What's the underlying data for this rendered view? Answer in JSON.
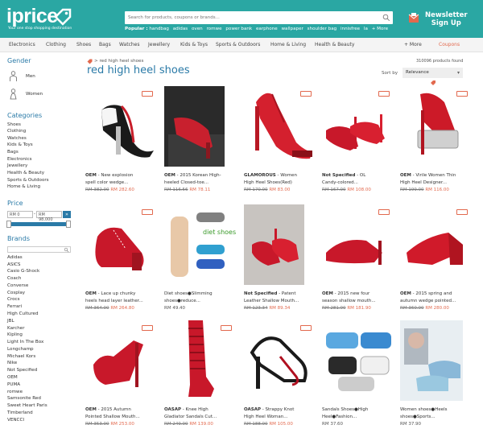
{
  "header": {
    "logo": "iprice",
    "tagline": "Your one stop shopping destination",
    "search_placeholder": "Search for products, coupons or brands...",
    "popular_label": "Popular :",
    "popular": [
      "handbag",
      "adidas",
      "oven",
      "romwe",
      "power bank",
      "earphone",
      "wallpaper",
      "shoulder bag",
      "innisfree",
      "la",
      "+ More"
    ],
    "newsletter_line1": "Newsletter",
    "newsletter_line2": "Sign Up"
  },
  "nav": {
    "items": [
      "Electronics",
      "Clothing",
      "Shoes",
      "Bags",
      "Watches",
      "Jewellery",
      "Kids & Toys",
      "Sports & Outdoors",
      "Home & Living",
      "Health & Beauty"
    ],
    "more": "+ More",
    "coupons": "Coupons"
  },
  "sidebar": {
    "gender_heading": "Gender",
    "gender": [
      "Men",
      "Women"
    ],
    "categories_heading": "Categories",
    "categories": [
      "Shoes",
      "Clothing",
      "Watches",
      "Kids & Toys",
      "Bags",
      "Electronics",
      "Jewellery",
      "Health & Beauty",
      "Sports & Outdoors",
      "Home & Living"
    ],
    "price_heading": "Price",
    "price_min": "RM 0",
    "price_max": "RM 98,000",
    "price_go": "»",
    "brands_heading": "Brands",
    "brands": [
      "Adidas",
      "ASICS",
      "Casio G-Shock",
      "Coach",
      "Converse",
      "Cosplay",
      "Crocs",
      "Ferrari",
      "High Cultured",
      "JBL",
      "Karcher",
      "Kipling",
      "Light In The Box",
      "Longchamp",
      "Michael Kors",
      "Nike",
      "Not Specified",
      "OEM",
      "PUMA",
      "romwe",
      "Samsonite Red",
      "Sweet Heart Paris",
      "Timberland",
      "VENCCI"
    ]
  },
  "main": {
    "breadcrumb": "red high heel shoes",
    "title": "red high heel shoes",
    "found": "310096 products found",
    "sort_label": "Sort by",
    "sort_value": "Relevance",
    "products": [
      {
        "brand": "OEM",
        "title": " - New explosion",
        "title2": "spell color wedge...",
        "old": "RM 382.00",
        "new": "RM 282.60"
      },
      {
        "brand": "OEM",
        "title": " - 2015 Korean High-",
        "title2": "heeled Closed-toe...",
        "old": "RM 116.56",
        "new": "RM 78.11"
      },
      {
        "brand": "GLAMOROUS",
        "title": " - Women",
        "title2": "High Heel Shoes(Red)",
        "old": "RM 170.00",
        "new": "RM 83.00"
      },
      {
        "brand": "Not Specified",
        "title": " - OL",
        "title2": "Candy-colored...",
        "old": "RM 167.00",
        "new": "RM 108.00"
      },
      {
        "brand": "OEM",
        "title": " - Virile Women Thin",
        "title2": "High Heel Designer...",
        "old": "RM 199.00",
        "new": "RM 116.00"
      },
      {
        "brand": "OEM",
        "title": " - Lace up chunky",
        "title2": "heels head layer leather...",
        "old": "RM 364.00",
        "new": "RM 264.80"
      },
      {
        "brand": "",
        "title": "Diet shoes●Slimming",
        "title2": "shoes●reduce...",
        "old": "",
        "new": "RM 49.40"
      },
      {
        "brand": "Not Specified",
        "title": " - Patent",
        "title2": "Leather Shallow Mouth...",
        "old": "RM 123.34",
        "new": "RM 89.34"
      },
      {
        "brand": "OEM",
        "title": " - 2015 new four",
        "title2": "season shallow mouth...",
        "old": "RM 281.00",
        "new": "RM 181.90"
      },
      {
        "brand": "OEM",
        "title": " - 2015 spring and",
        "title2": "autumn wedge pointed...",
        "old": "RM 360.00",
        "new": "RM 280.00"
      },
      {
        "brand": "OEM",
        "title": " - 2015 Autumn",
        "title2": "Pointed Shallow Mouth...",
        "old": "RM 353.00",
        "new": "RM 253.00"
      },
      {
        "brand": "OASAP",
        "title": " - Knee High",
        "title2": "Gladiator Sandals Cut...",
        "old": "RM 249.00",
        "new": "RM 139.00"
      },
      {
        "brand": "OASAP",
        "title": " - Strappy Knot",
        "title2": "High Heel Woman...",
        "old": "RM 188.00",
        "new": "RM 105.00"
      },
      {
        "brand": "",
        "title": "Sandals Shoes●High",
        "title2": "Heel●Fashion...",
        "old": "",
        "new": "RM 37.60"
      },
      {
        "brand": "",
        "title": "Women shoes●Heels",
        "title2": "shoes●Sports...",
        "old": "",
        "new": "RM 37.90"
      }
    ],
    "diet_label": "diet shoes"
  },
  "colors": {
    "teal": "#2aa7a3",
    "blue": "#2a7aa7",
    "accent": "#e2694e"
  }
}
